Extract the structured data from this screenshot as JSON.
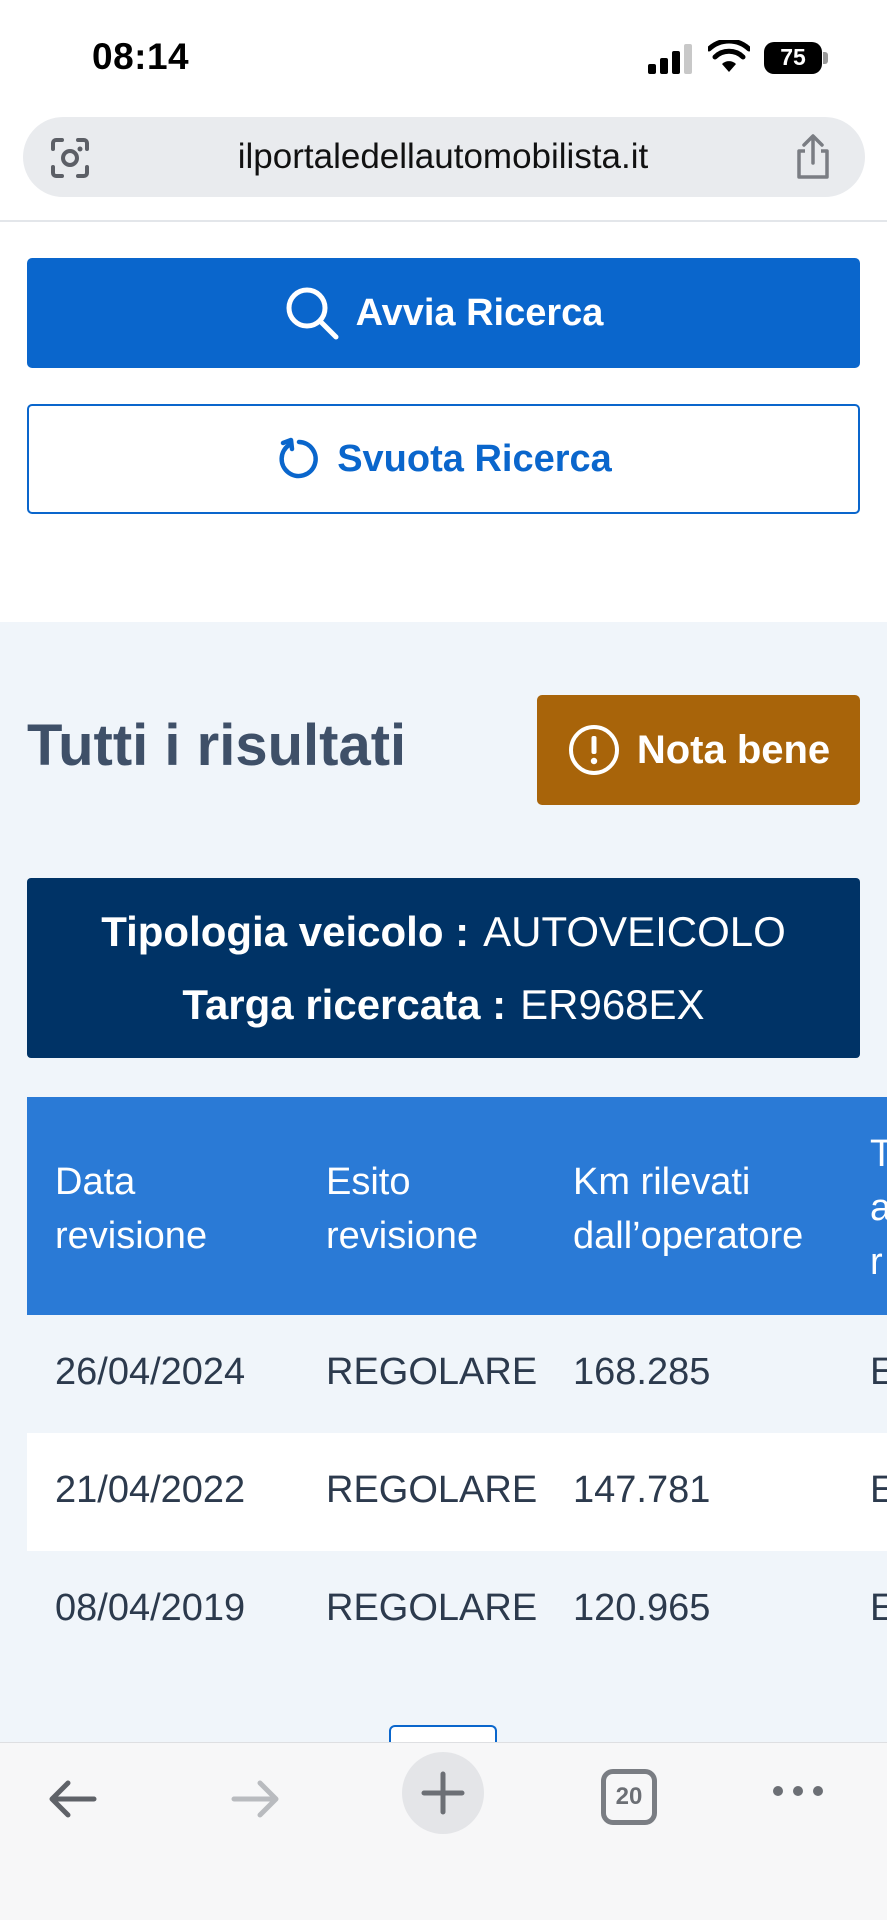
{
  "status_bar": {
    "time": "08:14",
    "battery": "75"
  },
  "browser": {
    "url": "ilportaledellautomobilista.it",
    "tab_count": "20"
  },
  "actions": {
    "search_label": "Avvia Ricerca",
    "clear_label": "Svuota Ricerca"
  },
  "results": {
    "title": "Tutti i risultati",
    "nota_bene_label": "Nota bene",
    "vehicle": {
      "type_key": "Tipologia veicolo :",
      "type_value": "AUTOVEICOLO",
      "plate_key": "Targa ricercata :",
      "plate_value": "ER968EX"
    },
    "table": {
      "headers": [
        {
          "line1": "Data",
          "line2": "revisione"
        },
        {
          "line1": "Esito",
          "line2": "revisione"
        },
        {
          "line1": "Km rilevati",
          "line2": "dall’operatore"
        },
        {
          "line1": "T",
          "line2": "a",
          "line3": "r"
        }
      ],
      "rows": [
        {
          "date": "26/04/2024",
          "outcome": "REGOLARE",
          "km": "168.285",
          "extra": "E"
        },
        {
          "date": "21/04/2022",
          "outcome": "REGOLARE",
          "km": "147.781",
          "extra": "E"
        },
        {
          "date": "08/04/2019",
          "outcome": "REGOLARE",
          "km": "120.965",
          "extra": "E"
        }
      ]
    }
  },
  "colors": {
    "primary": "#0a66cc",
    "warning": "#a8640a",
    "navy": "#003366",
    "table_header": "#2a7ad6"
  }
}
